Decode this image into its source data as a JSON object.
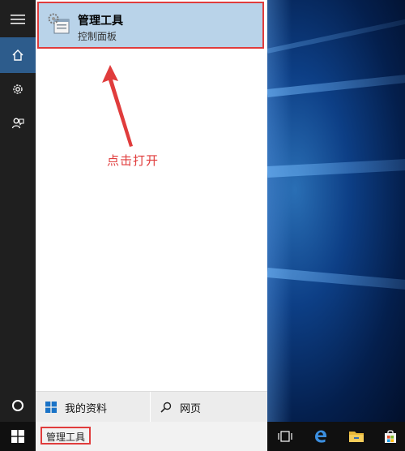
{
  "result": {
    "title": "管理工具",
    "subtitle": "控制面板"
  },
  "annotation": {
    "text": "点击打开",
    "color": "#e03c3c"
  },
  "bottom_bar": {
    "my_info_label": "我的资料",
    "web_label": "网页"
  },
  "search": {
    "query": "管理工具"
  },
  "rail": {
    "icons": [
      "hamburger-icon",
      "home-icon",
      "gear-icon",
      "feedback-icon",
      "cortana-circle-icon"
    ]
  },
  "taskbar": {
    "icons": [
      "windows-start-icon",
      "task-view-icon",
      "edge-icon",
      "file-explorer-icon",
      "store-icon"
    ]
  },
  "colors": {
    "rail_active": "#2d5c8c",
    "result_bg": "#b9d3e9",
    "highlight_border": "#e03c3c"
  }
}
